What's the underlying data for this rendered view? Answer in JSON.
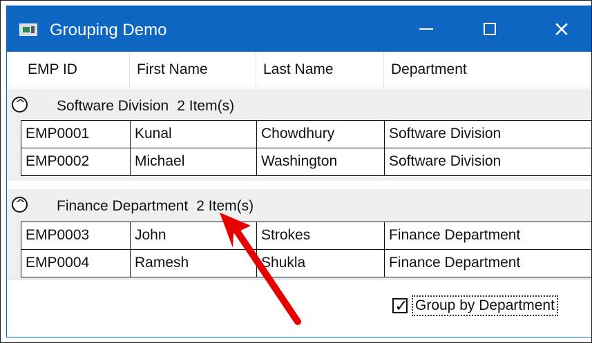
{
  "window": {
    "title": "Grouping Demo",
    "icon": "window-app-icon",
    "controls": {
      "minimize": "minimize",
      "maximize": "maximize",
      "close": "×"
    }
  },
  "grid": {
    "columns": [
      "EMP ID",
      "First Name",
      "Last Name",
      "Department"
    ],
    "groups": [
      {
        "name": "Software Division",
        "count_label": "2 Item(s)",
        "expander": "chevron-up-icon",
        "rows": [
          [
            "EMP0001",
            "Kunal",
            "Chowdhury",
            "Software Division"
          ],
          [
            "EMP0002",
            "Michael",
            "Washington",
            "Software Division"
          ]
        ]
      },
      {
        "name": "Finance Department",
        "count_label": "2 Item(s)",
        "expander": "chevron-up-icon",
        "rows": [
          [
            "EMP0003",
            "John",
            "Strokes",
            "Finance Department"
          ],
          [
            "EMP0004",
            "Ramesh",
            "Shukla",
            "Finance Department"
          ]
        ]
      }
    ]
  },
  "footer": {
    "group_by_department": {
      "checked": true,
      "label": "Group by Department"
    }
  },
  "annotation": {
    "arrow_color": "#e60000",
    "icon": "red-arrow-icon"
  },
  "colors": {
    "titlebar": "#0c66c2",
    "group_background": "#efefef"
  }
}
